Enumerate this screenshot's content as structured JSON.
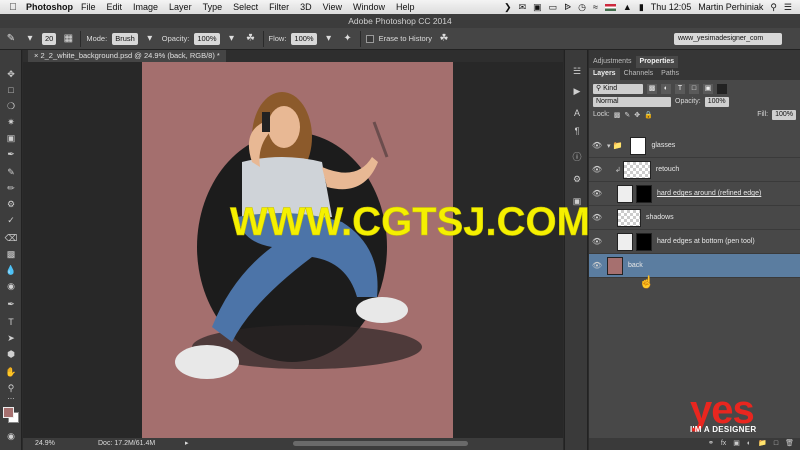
{
  "menubar": {
    "app_name": "Photoshop",
    "items": [
      "File",
      "Edit",
      "Image",
      "Layer",
      "Type",
      "Select",
      "Filter",
      "3D",
      "View",
      "Window",
      "Help"
    ],
    "clock": "Thu 12:05",
    "user": "Martin Perhiniak"
  },
  "window": {
    "title": "Adobe Photoshop CC 2014"
  },
  "options": {
    "brush_size": "20",
    "mode_label": "Mode:",
    "mode_value": "Brush",
    "opacity_label": "Opacity:",
    "opacity_value": "100%",
    "flow_label": "Flow:",
    "flow_value": "100%",
    "erase_to_history": "Erase to History",
    "workspace": "www_yesimadesigner_com"
  },
  "document": {
    "tab_title": "2_2_white_background.psd @ 24.9% (back, RGB/8) *",
    "zoom": "24.9%",
    "doc_info": "Doc: 17.2M/61.4M"
  },
  "panels": {
    "top_tabs": [
      "Adjustments",
      "Properties"
    ],
    "active_top_tab": "Properties",
    "layer_tabs": [
      "Layers",
      "Channels",
      "Paths"
    ],
    "active_layer_tab": "Layers",
    "filter_kind": "Kind",
    "blend_mode": "Normal",
    "opacity_label": "Opacity:",
    "opacity_value": "100%",
    "lock_label": "Lock:",
    "fill_label": "Fill:",
    "fill_value": "100%"
  },
  "layers": [
    {
      "name": "glasses",
      "type": "group",
      "selected": false
    },
    {
      "name": "retouch",
      "type": "clipped",
      "selected": false
    },
    {
      "name": "hard edges around (refined edge)",
      "type": "masked",
      "selected": false
    },
    {
      "name": "shadows",
      "type": "normal",
      "selected": false
    },
    {
      "name": "hard edges at bottom (pen tool)",
      "type": "masked",
      "selected": false
    },
    {
      "name": "back",
      "type": "fill",
      "selected": true
    }
  ],
  "colors": {
    "foreground": "#a6706f",
    "background": "#ffffff",
    "canvas_fill": "#a46f6e",
    "selection": "#5b7da0"
  },
  "watermark": {
    "text": "WWW.CGTSJ.COM",
    "logo_big": "yes",
    "logo_small": "I'M A DESIGNER"
  }
}
